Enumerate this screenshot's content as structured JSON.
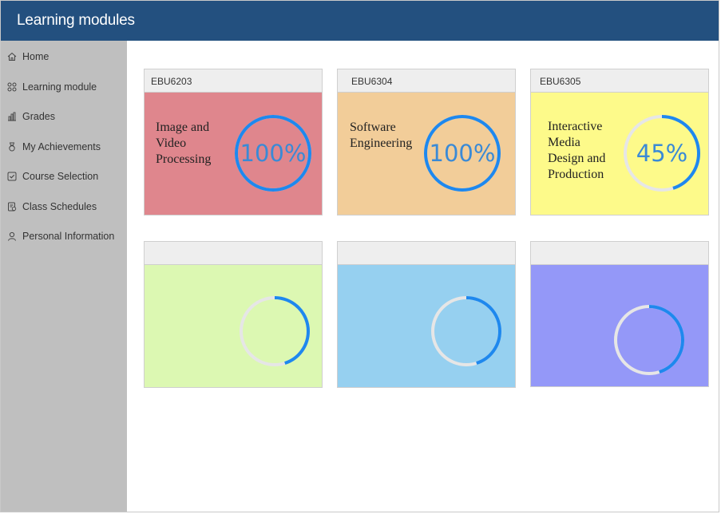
{
  "header": {
    "title": "Learning modules"
  },
  "sidebar": {
    "items": [
      {
        "label": "Home",
        "icon": "home-icon"
      },
      {
        "label": "Learning module",
        "icon": "grid-icon"
      },
      {
        "label": "Grades",
        "icon": "bar-chart-icon"
      },
      {
        "label": "My Achievements",
        "icon": "medal-icon"
      },
      {
        "label": "Course Selection",
        "icon": "course-select-icon"
      },
      {
        "label": "Class Schedules",
        "icon": "schedule-icon"
      },
      {
        "label": "Personal Information",
        "icon": "user-icon"
      }
    ]
  },
  "modules": [
    {
      "code": "EBU6203",
      "name": "Image and\nVideo\nProcessing",
      "progress_label": "100%",
      "progress": 1.0,
      "color": "#df868d"
    },
    {
      "code": "EBU6304",
      "name": "Software\nEngineering",
      "progress_label": "100%",
      "progress": 1.0,
      "color": "#f2cd99"
    },
    {
      "code": "EBU6305",
      "name": "Interactive\nMedia\nDesign and\nProduction",
      "progress_label": "45%",
      "progress": 0.45,
      "color": "#fdfa8a"
    },
    {
      "code": "",
      "name": "",
      "progress_label": "",
      "progress": 0.45,
      "color": "#dcf8b2"
    },
    {
      "code": "",
      "name": "",
      "progress_label": "",
      "progress": 0.45,
      "color": "#96d0f0"
    },
    {
      "code": "",
      "name": "",
      "progress_label": "",
      "progress": 0.45,
      "color": "#9498f8"
    }
  ],
  "colors": {
    "header": "#23507f",
    "sidebar": "#bfbfbf",
    "ring_fill": "#1e88ee",
    "ring_track": "#e6e6e6"
  }
}
